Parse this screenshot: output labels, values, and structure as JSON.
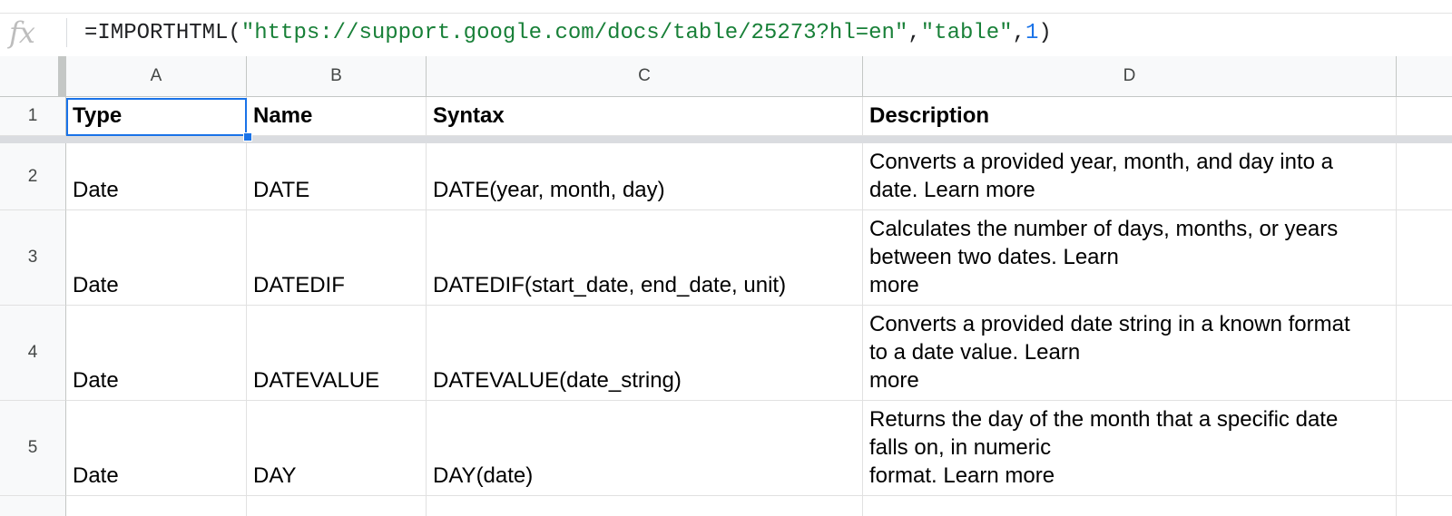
{
  "formula_bar": {
    "icon": "fx-icon",
    "prefix": "=IMPORTHTML(",
    "arg_url": "\"https://support.google.com/docs/table/25273?hl=en\"",
    "comma1": ",",
    "arg_query": "\"table\"",
    "comma2": ",",
    "arg_index": "1",
    "suffix": ")"
  },
  "columns": [
    "A",
    "B",
    "C",
    "D"
  ],
  "rows": [
    {
      "num": "1",
      "type": "Type",
      "name": "Name",
      "syntax": "Syntax",
      "description": "Description"
    },
    {
      "num": "2",
      "type": "Date",
      "name": "DATE",
      "syntax": "DATE(year, month, day)",
      "description": "Converts a provided year, month, and day into a\ndate. Learn more"
    },
    {
      "num": "3",
      "type": "Date",
      "name": "DATEDIF",
      "syntax": "DATEDIF(start_date, end_date, unit)",
      "description": "Calculates the number of days, months, or years\nbetween two dates. Learn\nmore"
    },
    {
      "num": "4",
      "type": "Date",
      "name": "DATEVALUE",
      "syntax": "DATEVALUE(date_string)",
      "description": "Converts a provided date string in a known format\nto a date value. Learn\nmore"
    },
    {
      "num": "5",
      "type": "Date",
      "name": "DAY",
      "syntax": "DAY(date)",
      "description": "Returns the day of the month that a specific date\nfalls on, in numeric\nformat. Learn more"
    }
  ],
  "selected_cell": "A1",
  "colors": {
    "selection": "#1a73e8",
    "string_literal": "#188038",
    "number_literal": "#1a73e8"
  }
}
